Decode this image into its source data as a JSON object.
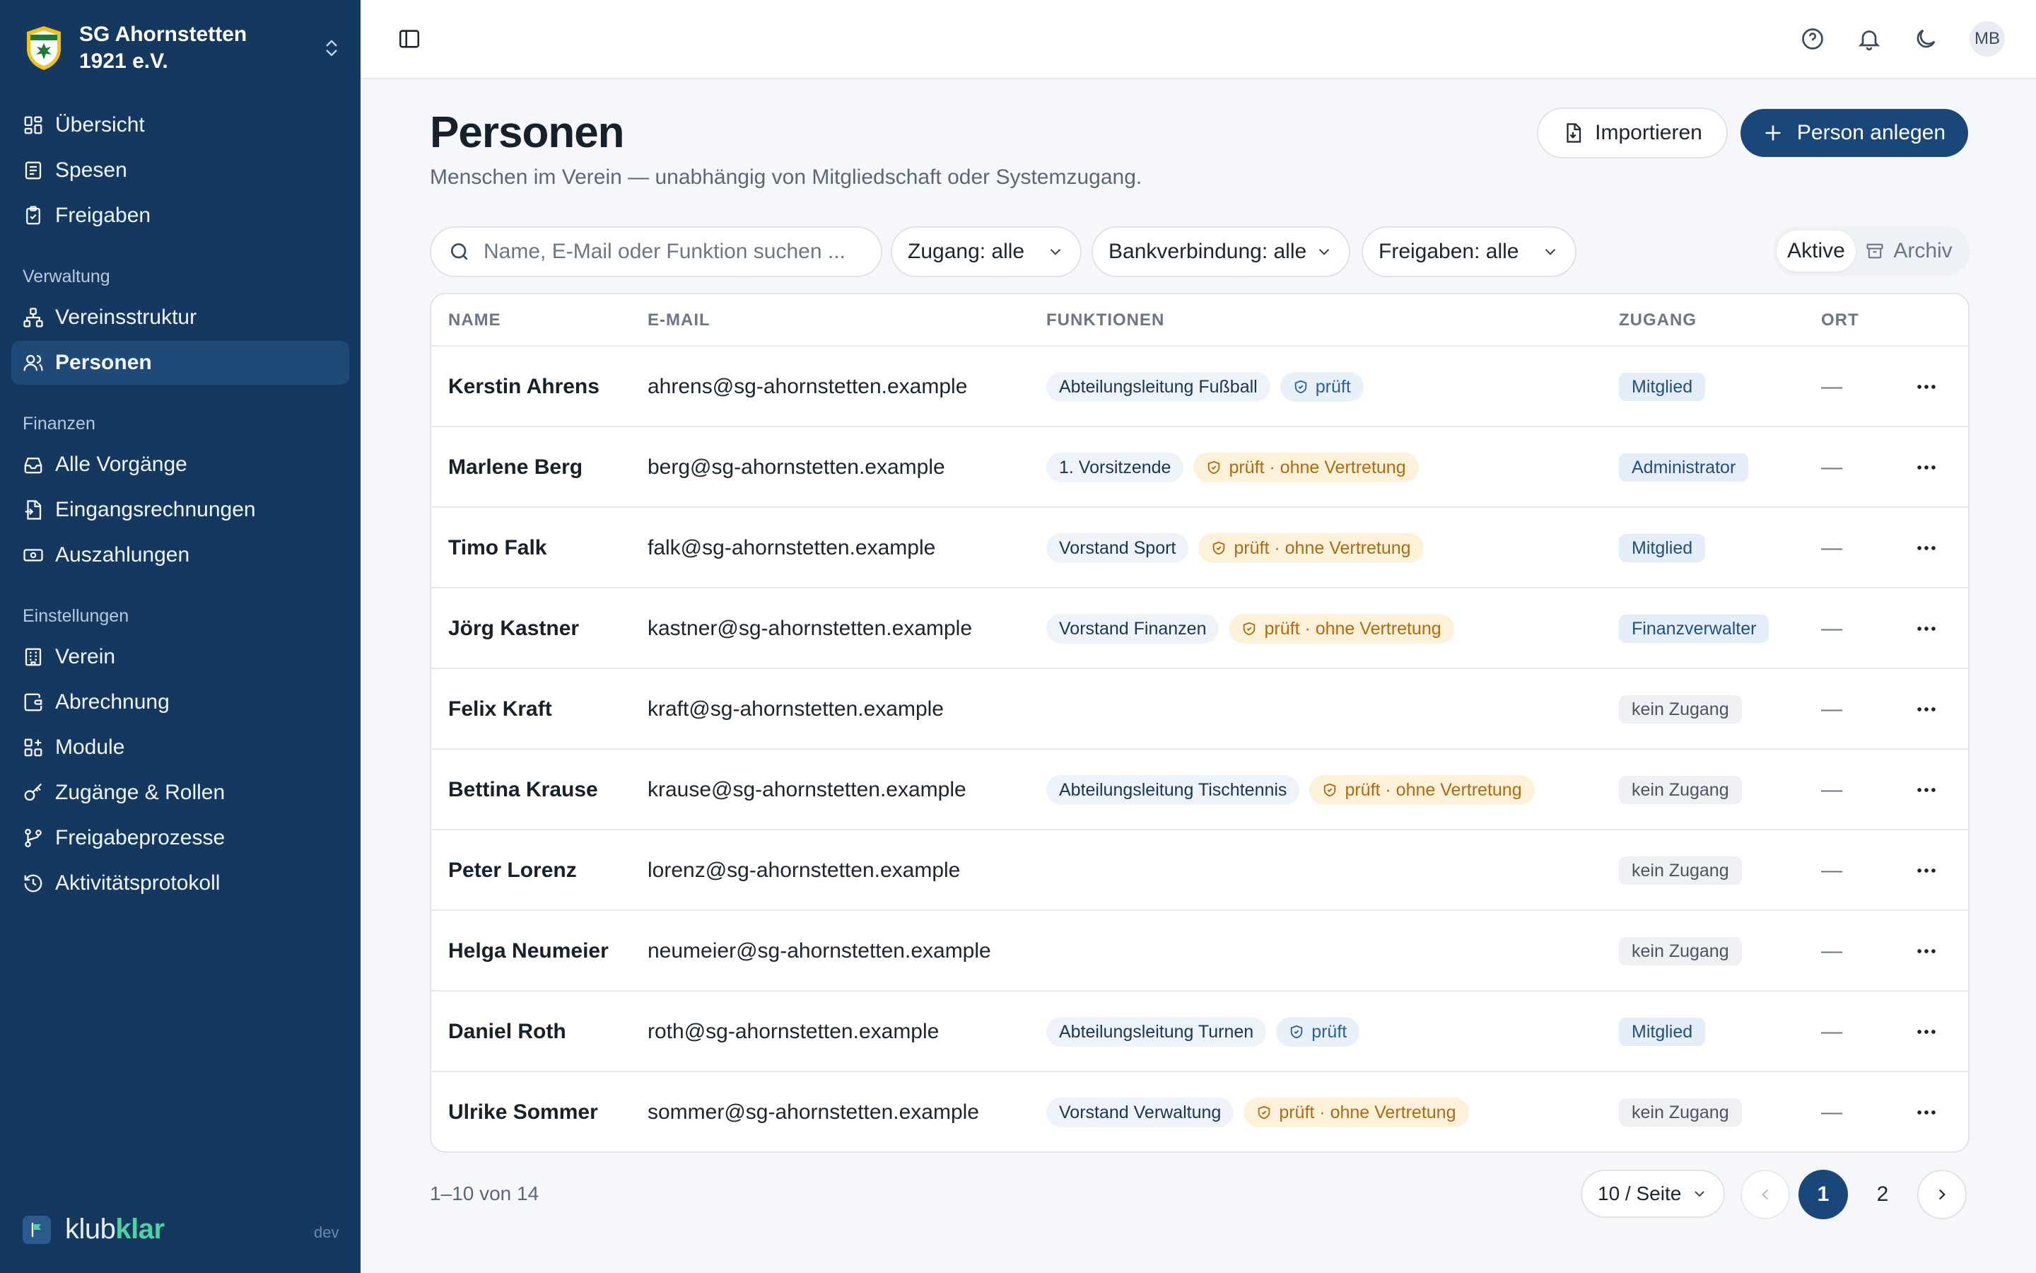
{
  "org": {
    "name": "SG Ahornstetten 1921 e.V."
  },
  "nav": {
    "items_top": [
      {
        "label": "Übersicht",
        "icon": "dashboard-icon"
      },
      {
        "label": "Spesen",
        "icon": "receipt-icon"
      },
      {
        "label": "Freigaben",
        "icon": "clipboard-check-icon"
      }
    ],
    "verwaltung": {
      "title": "Verwaltung",
      "items": [
        {
          "label": "Vereinsstruktur",
          "icon": "hierarchy-icon"
        },
        {
          "label": "Personen",
          "icon": "users-icon",
          "active": true
        }
      ]
    },
    "finanzen": {
      "title": "Finanzen",
      "items": [
        {
          "label": "Alle Vorgänge",
          "icon": "inbox-icon"
        },
        {
          "label": "Eingangsrechnungen",
          "icon": "invoice-icon"
        },
        {
          "label": "Auszahlungen",
          "icon": "banknote-icon"
        }
      ]
    },
    "einstellungen": {
      "title": "Einstellungen",
      "items": [
        {
          "label": "Verein",
          "icon": "building-icon"
        },
        {
          "label": "Abrechnung",
          "icon": "wallet-icon"
        },
        {
          "label": "Module",
          "icon": "grid-plus-icon"
        },
        {
          "label": "Zugänge & Rollen",
          "icon": "key-icon"
        },
        {
          "label": "Freigabeprozesse",
          "icon": "git-branch-icon"
        },
        {
          "label": "Aktivitätsprotokoll",
          "icon": "history-icon"
        }
      ]
    }
  },
  "brand": {
    "klub": "klub",
    "klar": "klar",
    "env": "dev"
  },
  "topbar": {
    "avatar": "MB"
  },
  "page": {
    "title": "Personen",
    "subtitle": "Menschen im Verein — unabhängig von Mitgliedschaft oder Systemzugang."
  },
  "actions": {
    "import": "Importieren",
    "create": "Person anlegen"
  },
  "filters": {
    "search_placeholder": "Name, E-Mail oder Funktion suchen ...",
    "access": "Zugang: alle",
    "bank": "Bankverbindung: alle",
    "approvals": "Freigaben: alle",
    "seg_active": "Aktive",
    "seg_archive": "Archiv"
  },
  "table": {
    "headers": {
      "name": "NAME",
      "email": "E-MAIL",
      "functions": "FUNKTIONEN",
      "access": "ZUGANG",
      "place": "ORT"
    },
    "rows": [
      {
        "name": "Kerstin Ahrens",
        "email": "ahrens@sg-ahornstetten.example",
        "function": "Abteilungsleitung Fußball",
        "check": "prüft",
        "check_type": "ok",
        "access": "Mitglied",
        "access_type": "blue",
        "place": "—"
      },
      {
        "name": "Marlene Berg",
        "email": "berg@sg-ahornstetten.example",
        "function": "1. Vorsitzende",
        "check": "prüft · ohne Vertretung",
        "check_type": "warn",
        "access": "Administrator",
        "access_type": "blue",
        "place": "—"
      },
      {
        "name": "Timo Falk",
        "email": "falk@sg-ahornstetten.example",
        "function": "Vorstand Sport",
        "check": "prüft · ohne Vertretung",
        "check_type": "warn",
        "access": "Mitglied",
        "access_type": "blue",
        "place": "—"
      },
      {
        "name": "Jörg Kastner",
        "email": "kastner@sg-ahornstetten.example",
        "function": "Vorstand Finanzen",
        "check": "prüft · ohne Vertretung",
        "check_type": "warn",
        "access": "Finanzverwalter",
        "access_type": "blue",
        "place": "—"
      },
      {
        "name": "Felix Kraft",
        "email": "kraft@sg-ahornstetten.example",
        "function": "",
        "check": "",
        "check_type": "",
        "access": "kein Zugang",
        "access_type": "gray",
        "place": "—"
      },
      {
        "name": "Bettina Krause",
        "email": "krause@sg-ahornstetten.example",
        "function": "Abteilungsleitung Tischtennis",
        "check": "prüft · ohne Vertretung",
        "check_type": "warn",
        "access": "kein Zugang",
        "access_type": "gray",
        "place": "—"
      },
      {
        "name": "Peter Lorenz",
        "email": "lorenz@sg-ahornstetten.example",
        "function": "",
        "check": "",
        "check_type": "",
        "access": "kein Zugang",
        "access_type": "gray",
        "place": "—"
      },
      {
        "name": "Helga Neumeier",
        "email": "neumeier@sg-ahornstetten.example",
        "function": "",
        "check": "",
        "check_type": "",
        "access": "kein Zugang",
        "access_type": "gray",
        "place": "—"
      },
      {
        "name": "Daniel Roth",
        "email": "roth@sg-ahornstetten.example",
        "function": "Abteilungsleitung Turnen",
        "check": "prüft",
        "check_type": "ok",
        "access": "Mitglied",
        "access_type": "blue",
        "place": "—"
      },
      {
        "name": "Ulrike Sommer",
        "email": "sommer@sg-ahornstetten.example",
        "function": "Vorstand Verwaltung",
        "check": "prüft · ohne Vertretung",
        "check_type": "warn",
        "access": "kein Zugang",
        "access_type": "gray",
        "place": "—"
      }
    ]
  },
  "pagination": {
    "info": "1–10 von 14",
    "per_page": "10 / Seite",
    "pages": [
      "1",
      "2"
    ],
    "current": "1"
  },
  "colors": {
    "sidebar": "#14385f",
    "primary": "#1a477a",
    "warn_bg": "#fdf1da",
    "warn_text": "#b06a10"
  }
}
